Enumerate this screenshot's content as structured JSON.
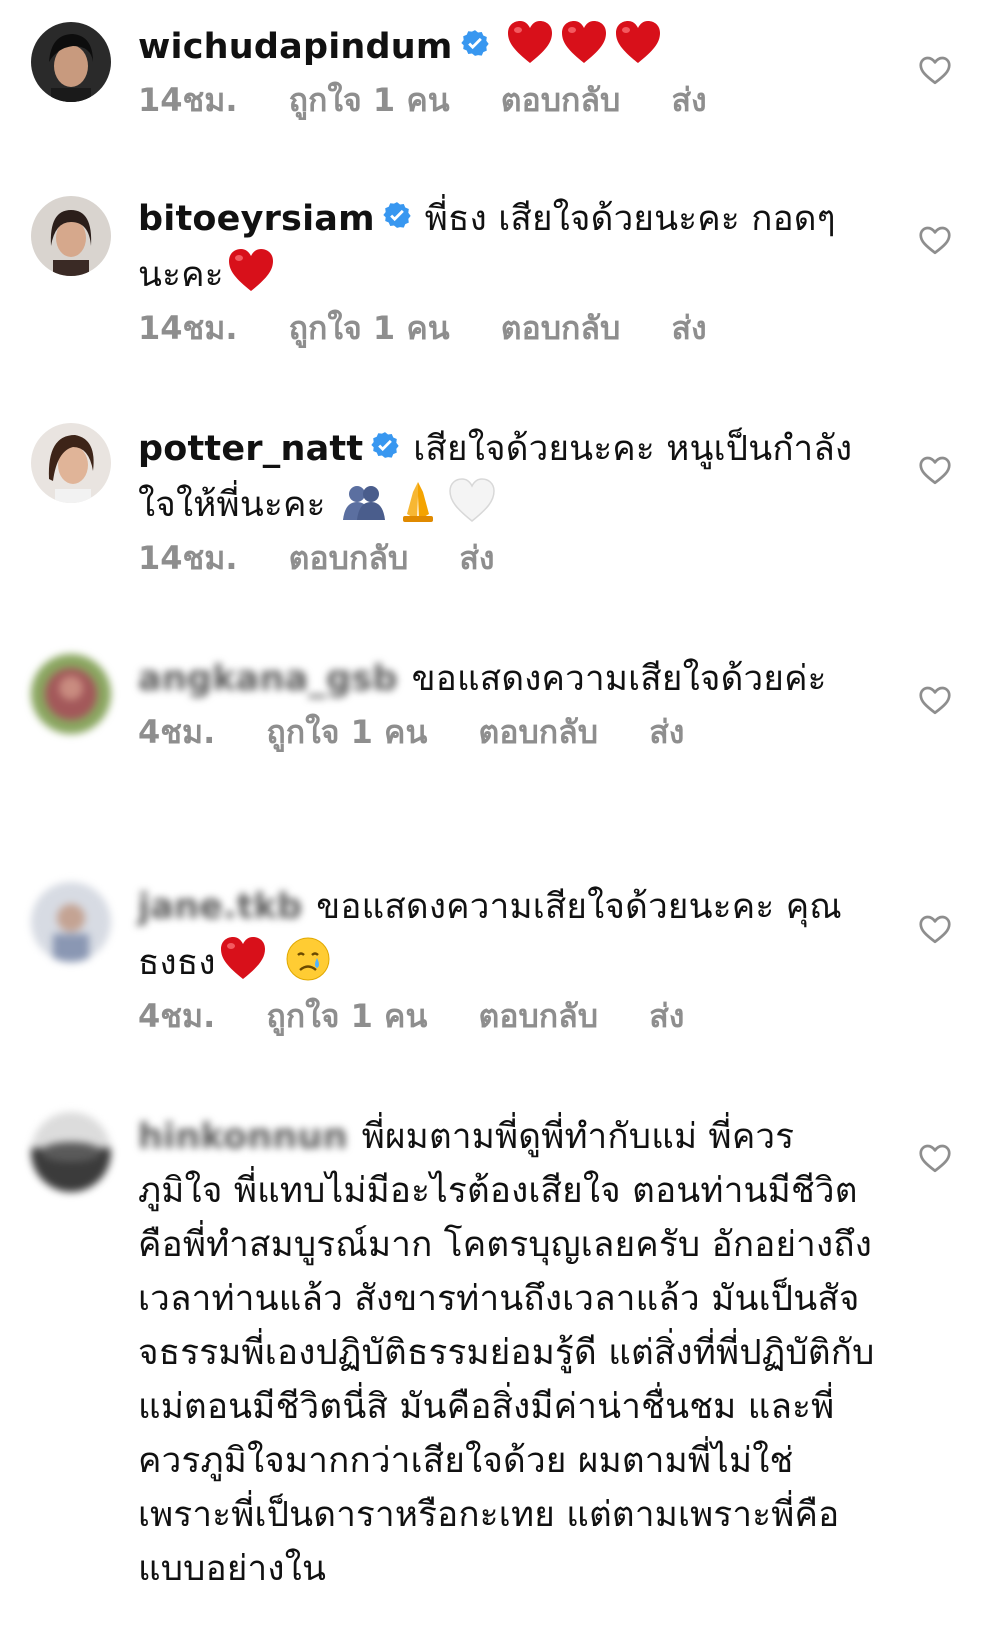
{
  "comments": [
    {
      "username": "wichudapindum",
      "verified": true,
      "text": "",
      "emojis": [
        "red-heart",
        "red-heart",
        "red-heart"
      ],
      "time": "14ชม.",
      "likes": "ถูกใจ 1 คน",
      "reply": "ตอบกลับ",
      "send": "ส่ง"
    },
    {
      "username": "bitoeyrsiam",
      "verified": true,
      "text": "พี่ธง เสียใจด้วยนะคะ กอดๆนะคะ",
      "emojis": [
        "red-heart"
      ],
      "time": "14ชม.",
      "likes": "ถูกใจ 1 คน",
      "reply": "ตอบกลับ",
      "send": "ส่ง"
    },
    {
      "username": "potter_natt",
      "verified": true,
      "text": "เสียใจด้วยนะคะ หนูเป็นกำลังใจให้พี่นะคะ",
      "emojis": [
        "hugging-people",
        "folded-hands",
        "white-heart"
      ],
      "time": "14ชม.",
      "reply": "ตอบกลับ",
      "send": "ส่ง"
    },
    {
      "username": "angkana_gsb",
      "verified": false,
      "text": "ขอแสดงความเสียใจด้วยค่ะ",
      "time": "4ชม.",
      "likes": "ถูกใจ 1 คน",
      "reply": "ตอบกลับ",
      "send": "ส่ง"
    },
    {
      "username": "jane.tkb",
      "verified": false,
      "text": "ขอแสดงความเสียใจด้วยนะคะ คุณธงธง",
      "emojis": [
        "red-heart",
        "crying-face"
      ],
      "time": "4ชม.",
      "likes": "ถูกใจ 1 คน",
      "reply": "ตอบกลับ",
      "send": "ส่ง"
    },
    {
      "username": "hinkonnun",
      "verified": false,
      "text": "พี่ผมตามพี่ดูพี่ทำกับแม่ พี่ควรภูมิใจ พี่แทบไม่มีอะไรต้องเสียใจ ตอนท่านมีชีวิตคือพี่ทำสมบูรณ์มาก โคตรบุญเลยครับ อักอย่างถึงเวลาท่านแล้ว สังขารท่านถึงเวลาแล้ว มันเป็นสัจจธรรมพี่เองปฏิบัติธรรมย่อมรู้ดี แต่สิ่งที่พี่ปฏิบัติกับแม่ตอนมีชีวิตนี่สิ มันคือสิ่งมีค่าน่าชื่นชม และพี่ควรภูมิใจมากกว่าเสียใจด้วย ผมตามพี่ไม่ใช่เพราะพี่เป็นดาราหรือกะเทย แต่ตามเพราะพี่คือแบบอย่างใน"
    }
  ],
  "colors": {
    "text": "#111111",
    "meta": "#8e8e8e",
    "verified": "#3897f0",
    "heart": "#ed1c24"
  }
}
